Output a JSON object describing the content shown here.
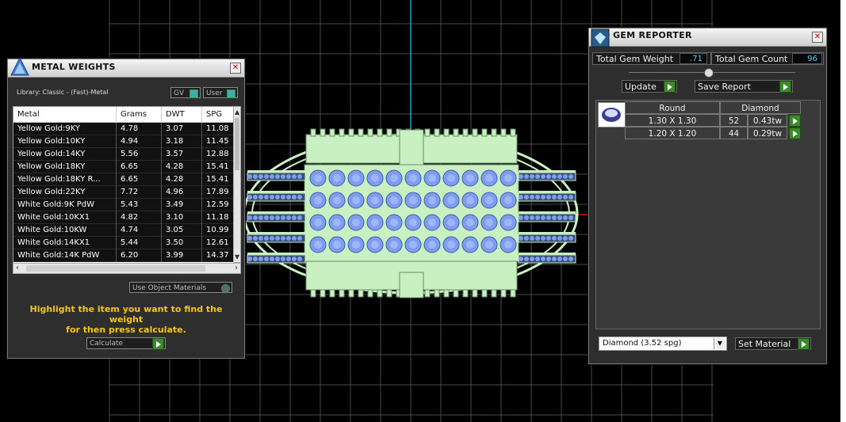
{
  "viewport": {
    "name": "3d-viewport"
  },
  "metal_weights": {
    "title": "METAL WEIGHTS",
    "library": "Library: Classic - (Fast)-Metal",
    "toggle_gv": "GV",
    "toggle_user": "User",
    "columns": [
      "Metal",
      "Grams",
      "DWT",
      "SPG"
    ],
    "rows": [
      [
        "Yellow Gold:9KY",
        "4.78",
        "3.07",
        "11.08"
      ],
      [
        "Yellow Gold:10KY",
        "4.94",
        "3.18",
        "11.45"
      ],
      [
        "Yellow Gold:14KY",
        "5.56",
        "3.57",
        "12.88"
      ],
      [
        "Yellow Gold:18KY",
        "6.65",
        "4.28",
        "15.41"
      ],
      [
        "Yellow Gold:18KY R...",
        "6.65",
        "4.28",
        "15.41"
      ],
      [
        "Yellow Gold:22KY",
        "7.72",
        "4.96",
        "17.89"
      ],
      [
        "White Gold:9K PdW",
        "5.43",
        "3.49",
        "12.59"
      ],
      [
        "White Gold:10KX1",
        "4.82",
        "3.10",
        "11.18"
      ],
      [
        "White Gold:10KW",
        "4.74",
        "3.05",
        "10.99"
      ],
      [
        "White Gold:14KX1",
        "5.44",
        "3.50",
        "12.61"
      ],
      [
        "White Gold:14K PdW",
        "6.20",
        "3.99",
        "14.37"
      ]
    ],
    "use_object_materials": "Use Object Materials",
    "hint_line1": "Highlight the item you want to find the weight",
    "hint_line2": "for then press calculate.",
    "calculate": "Calculate"
  },
  "gem_reporter": {
    "title": "GEM REPORTER",
    "total_gem_weight_label": "Total Gem Weight",
    "total_gem_weight_value": ".71",
    "total_gem_count_label": "Total Gem Count",
    "total_gem_count_value": "96",
    "update": "Update",
    "save_report": "Save Report",
    "col_shape": "Round",
    "col_material": "Diamond",
    "gems": [
      {
        "size": "1.30 X 1.30",
        "count": "52",
        "weight": "0.43tw"
      },
      {
        "size": "1.20 X 1.20",
        "count": "44",
        "weight": "0.29tw"
      }
    ],
    "material_select": "Diamond     (3.52 spg)",
    "set_material": "Set Material"
  },
  "colors": {
    "ring_metal": "#c8f0c0",
    "gem_blue": "#7e9cf0",
    "grid": "#5a5a5a",
    "hint": "#f5c518"
  }
}
